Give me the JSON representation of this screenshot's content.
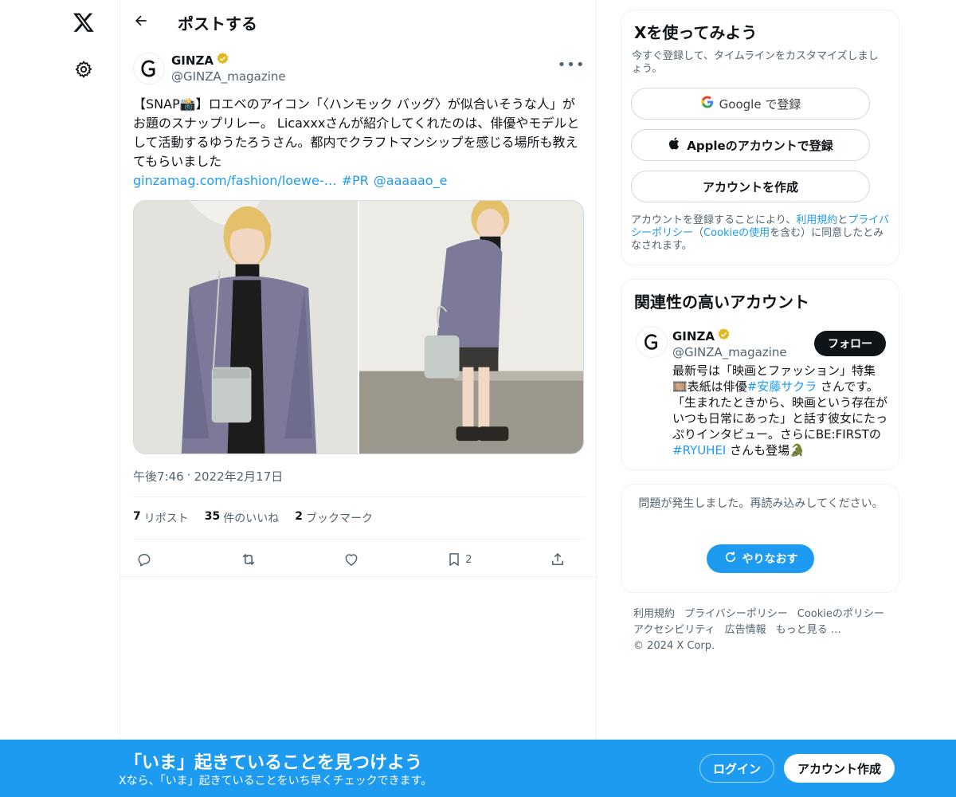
{
  "colors": {
    "accent": "#1d9bf0",
    "text": "#0f1419",
    "muted": "#536471",
    "verified": "#e2b719"
  },
  "header": {
    "title": "ポストする"
  },
  "post": {
    "author_name": "GINZA",
    "author_handle": "@GINZA_magazine",
    "text": "【SNAP📸】ロエベのアイコン「〈ハンモック バッグ〉が似合いそうな人」がお題のスナップリレー。 Licaxxxさんが紹介してくれたのは、俳優やモデルとして活動するゆうたろうさん。都内でクラフトマンシップを感じる場所も教えてもらいました",
    "link_url": "ginzamag.com/fashion/loewe-…",
    "hashtag": "#PR",
    "mention": "@aaaaao_e",
    "time": "午後7:46",
    "separator": "·",
    "date": "2022年2月17日",
    "stats": [
      {
        "count": "7",
        "label": "リポスト"
      },
      {
        "count": "35",
        "label": "件のいいね"
      },
      {
        "count": "2",
        "label": "ブックマーク"
      }
    ],
    "bookmark_count": "2"
  },
  "signup_card": {
    "title": "Xを使ってみよう",
    "subtitle": "今すぐ登録して、タイムラインをカスタマイズしましょう。",
    "google_label": "Google で登録",
    "apple_label": "Appleのアカウントで登録",
    "create_label": "アカウントを作成",
    "terms_1": "アカウントを登録することにより、",
    "terms_link_1": "利用規約",
    "terms_2": "と",
    "terms_link_2": "プライバシーポリシー",
    "terms_3": "（",
    "terms_link_3": "Cookieの使用",
    "terms_4": "を含む）に同意したとみなされます。"
  },
  "relevant": {
    "title": "関連性の高いアカウント",
    "name": "GINZA",
    "handle": "@GINZA_magazine",
    "follow_label": "フォロー",
    "bio_1": "最新号は「映画とファッション」特集🎞️表紙は俳優",
    "bio_tag_1": "#安藤サクラ",
    "bio_2": " さんです。「生まれたときから、映画という存在がいつも日常にあった」と話す彼女にたっぷりインタビュー。さらにBE:FIRSTの",
    "bio_tag_2": "#RYUHEI",
    "bio_3": " さんも登場🐊"
  },
  "error_card": {
    "message": "問題が発生しました。再読み込みしてください。",
    "retry_label": "やりなおす"
  },
  "footer": {
    "links": [
      "利用規約",
      "プライバシーポリシー",
      "Cookieのポリシー",
      "アクセシビリティ",
      "広告情報",
      "もっと見る …"
    ],
    "copyright": "© 2024 X Corp."
  },
  "bottom_bar": {
    "title": "「いま」起きていることを見つけよう",
    "subtitle": "Xなら、「いま」起きていることをいち早くチェックできます。",
    "login_label": "ログイン",
    "signup_label": "アカウント作成"
  }
}
